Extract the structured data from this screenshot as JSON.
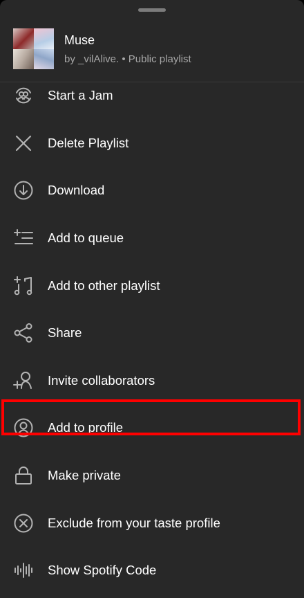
{
  "playlist": {
    "title": "Muse",
    "subtitle": "by _vilAlive. • Public playlist"
  },
  "menu": {
    "items": [
      {
        "label": "Start a Jam",
        "icon": "jam-icon"
      },
      {
        "label": "Delete Playlist",
        "icon": "close-icon"
      },
      {
        "label": "Download",
        "icon": "download-icon"
      },
      {
        "label": "Add to queue",
        "icon": "add-to-queue-icon"
      },
      {
        "label": "Add to other playlist",
        "icon": "add-to-playlist-icon"
      },
      {
        "label": "Share",
        "icon": "share-icon"
      },
      {
        "label": "Invite collaborators",
        "icon": "add-user-icon"
      },
      {
        "label": "Add to profile",
        "icon": "profile-icon"
      },
      {
        "label": "Make private",
        "icon": "lock-icon"
      },
      {
        "label": "Exclude from your taste profile",
        "icon": "exclude-icon"
      },
      {
        "label": "Show Spotify Code",
        "icon": "spotify-code-icon"
      }
    ]
  },
  "colors": {
    "sheet_background": "#282828",
    "text_primary": "#ffffff",
    "text_secondary": "#a7a7a7",
    "highlight": "#ff0000"
  }
}
